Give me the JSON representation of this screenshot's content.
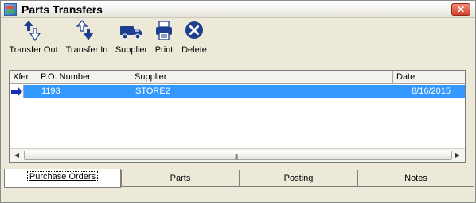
{
  "window": {
    "title": "Parts Transfers",
    "close_glyph": "✕"
  },
  "toolbar": {
    "transfer_out": "Transfer Out",
    "transfer_in": "Transfer In",
    "supplier": "Supplier",
    "print": "Print",
    "delete": "Delete"
  },
  "list": {
    "columns": [
      "Xfer",
      "P.O. Number",
      "Supplier",
      "Date"
    ],
    "rows": [
      {
        "po_number": "1193",
        "supplier": "STORE2",
        "date": "8/16/2015"
      }
    ]
  },
  "scrollbar": {
    "left_arrow": "◀",
    "right_arrow": "▶",
    "grip": "|||"
  },
  "tabs": [
    "Purchase Orders",
    "Parts",
    "Posting",
    "Notes"
  ],
  "colors": {
    "selection": "#3399ff",
    "toolbar_icon": "#1e3f8f"
  }
}
